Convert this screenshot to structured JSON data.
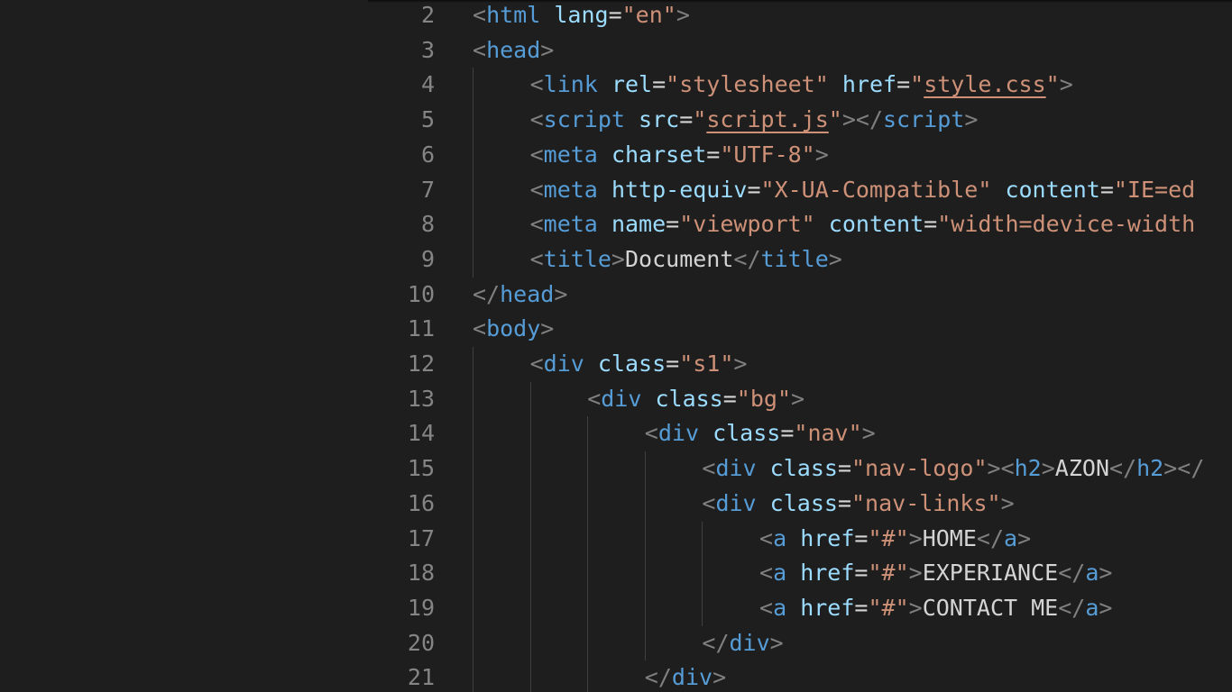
{
  "colors": {
    "background": "#1e1e1e",
    "line_number": "#858585",
    "bracket": "#808080",
    "tag": "#569cd6",
    "attribute": "#9cdcfe",
    "string": "#ce9178",
    "text": "#d4d4d4"
  },
  "editor": {
    "lines": [
      {
        "num": "2",
        "indent": 0,
        "tokens": [
          [
            "b",
            "<"
          ],
          [
            "t",
            "html"
          ],
          [
            "w",
            " "
          ],
          [
            "a",
            "lang"
          ],
          [
            "w",
            "="
          ],
          [
            "s",
            "\"en\""
          ],
          [
            "b",
            ">"
          ]
        ]
      },
      {
        "num": "3",
        "indent": 0,
        "tokens": [
          [
            "b",
            "<"
          ],
          [
            "t",
            "head"
          ],
          [
            "b",
            ">"
          ]
        ]
      },
      {
        "num": "4",
        "indent": 1,
        "tokens": [
          [
            "b",
            "<"
          ],
          [
            "t",
            "link"
          ],
          [
            "w",
            " "
          ],
          [
            "a",
            "rel"
          ],
          [
            "w",
            "="
          ],
          [
            "s",
            "\"stylesheet\""
          ],
          [
            "w",
            " "
          ],
          [
            "a",
            "href"
          ],
          [
            "w",
            "="
          ],
          [
            "s",
            "\""
          ],
          [
            "u",
            "style.css"
          ],
          [
            "s",
            "\""
          ],
          [
            "b",
            ">"
          ]
        ]
      },
      {
        "num": "5",
        "indent": 1,
        "tokens": [
          [
            "b",
            "<"
          ],
          [
            "t",
            "script"
          ],
          [
            "w",
            " "
          ],
          [
            "a",
            "src"
          ],
          [
            "w",
            "="
          ],
          [
            "s",
            "\""
          ],
          [
            "u",
            "script.js"
          ],
          [
            "s",
            "\""
          ],
          [
            "b",
            "></"
          ],
          [
            "t",
            "script"
          ],
          [
            "b",
            ">"
          ]
        ]
      },
      {
        "num": "6",
        "indent": 1,
        "tokens": [
          [
            "b",
            "<"
          ],
          [
            "t",
            "meta"
          ],
          [
            "w",
            " "
          ],
          [
            "a",
            "charset"
          ],
          [
            "w",
            "="
          ],
          [
            "s",
            "\"UTF-8\""
          ],
          [
            "b",
            ">"
          ]
        ]
      },
      {
        "num": "7",
        "indent": 1,
        "tokens": [
          [
            "b",
            "<"
          ],
          [
            "t",
            "meta"
          ],
          [
            "w",
            " "
          ],
          [
            "a",
            "http-equiv"
          ],
          [
            "w",
            "="
          ],
          [
            "s",
            "\"X-UA-Compatible\""
          ],
          [
            "w",
            " "
          ],
          [
            "a",
            "content"
          ],
          [
            "w",
            "="
          ],
          [
            "s",
            "\"IE=ed"
          ]
        ]
      },
      {
        "num": "8",
        "indent": 1,
        "tokens": [
          [
            "b",
            "<"
          ],
          [
            "t",
            "meta"
          ],
          [
            "w",
            " "
          ],
          [
            "a",
            "name"
          ],
          [
            "w",
            "="
          ],
          [
            "s",
            "\"viewport\""
          ],
          [
            "w",
            " "
          ],
          [
            "a",
            "content"
          ],
          [
            "w",
            "="
          ],
          [
            "s",
            "\"width=device-width"
          ]
        ]
      },
      {
        "num": "9",
        "indent": 1,
        "tokens": [
          [
            "b",
            "<"
          ],
          [
            "t",
            "title"
          ],
          [
            "b",
            ">"
          ],
          [
            "x",
            "Document"
          ],
          [
            "b",
            "</"
          ],
          [
            "t",
            "title"
          ],
          [
            "b",
            ">"
          ]
        ]
      },
      {
        "num": "10",
        "indent": 0,
        "tokens": [
          [
            "b",
            "</"
          ],
          [
            "t",
            "head"
          ],
          [
            "b",
            ">"
          ]
        ]
      },
      {
        "num": "11",
        "indent": 0,
        "tokens": [
          [
            "b",
            "<"
          ],
          [
            "t",
            "body"
          ],
          [
            "b",
            ">"
          ]
        ]
      },
      {
        "num": "12",
        "indent": 1,
        "tokens": [
          [
            "b",
            "<"
          ],
          [
            "t",
            "div"
          ],
          [
            "w",
            " "
          ],
          [
            "a",
            "class"
          ],
          [
            "w",
            "="
          ],
          [
            "s",
            "\"s1\""
          ],
          [
            "b",
            ">"
          ]
        ]
      },
      {
        "num": "13",
        "indent": 2,
        "tokens": [
          [
            "b",
            "<"
          ],
          [
            "t",
            "div"
          ],
          [
            "w",
            " "
          ],
          [
            "a",
            "class"
          ],
          [
            "w",
            "="
          ],
          [
            "s",
            "\"bg\""
          ],
          [
            "b",
            ">"
          ]
        ]
      },
      {
        "num": "14",
        "indent": 3,
        "tokens": [
          [
            "b",
            "<"
          ],
          [
            "t",
            "div"
          ],
          [
            "w",
            " "
          ],
          [
            "a",
            "class"
          ],
          [
            "w",
            "="
          ],
          [
            "s",
            "\"nav\""
          ],
          [
            "b",
            ">"
          ]
        ]
      },
      {
        "num": "15",
        "indent": 4,
        "tokens": [
          [
            "b",
            "<"
          ],
          [
            "t",
            "div"
          ],
          [
            "w",
            " "
          ],
          [
            "a",
            "class"
          ],
          [
            "w",
            "="
          ],
          [
            "s",
            "\"nav-logo\""
          ],
          [
            "b",
            "><"
          ],
          [
            "t",
            "h2"
          ],
          [
            "b",
            ">"
          ],
          [
            "x",
            "AZON"
          ],
          [
            "b",
            "</"
          ],
          [
            "t",
            "h2"
          ],
          [
            "b",
            "></"
          ]
        ]
      },
      {
        "num": "16",
        "indent": 4,
        "tokens": [
          [
            "b",
            "<"
          ],
          [
            "t",
            "div"
          ],
          [
            "w",
            " "
          ],
          [
            "a",
            "class"
          ],
          [
            "w",
            "="
          ],
          [
            "s",
            "\"nav-links\""
          ],
          [
            "b",
            ">"
          ]
        ]
      },
      {
        "num": "17",
        "indent": 5,
        "tokens": [
          [
            "b",
            "<"
          ],
          [
            "t",
            "a"
          ],
          [
            "w",
            " "
          ],
          [
            "a",
            "href"
          ],
          [
            "w",
            "="
          ],
          [
            "s",
            "\"#\""
          ],
          [
            "b",
            ">"
          ],
          [
            "x",
            "HOME"
          ],
          [
            "b",
            "</"
          ],
          [
            "t",
            "a"
          ],
          [
            "b",
            ">"
          ]
        ]
      },
      {
        "num": "18",
        "indent": 5,
        "tokens": [
          [
            "b",
            "<"
          ],
          [
            "t",
            "a"
          ],
          [
            "w",
            " "
          ],
          [
            "a",
            "href"
          ],
          [
            "w",
            "="
          ],
          [
            "s",
            "\"#\""
          ],
          [
            "b",
            ">"
          ],
          [
            "x",
            "EXPERIANCE"
          ],
          [
            "b",
            "</"
          ],
          [
            "t",
            "a"
          ],
          [
            "b",
            ">"
          ]
        ]
      },
      {
        "num": "19",
        "indent": 5,
        "tokens": [
          [
            "b",
            "<"
          ],
          [
            "t",
            "a"
          ],
          [
            "w",
            " "
          ],
          [
            "a",
            "href"
          ],
          [
            "w",
            "="
          ],
          [
            "s",
            "\"#\""
          ],
          [
            "b",
            ">"
          ],
          [
            "x",
            "CONTACT ME"
          ],
          [
            "b",
            "</"
          ],
          [
            "t",
            "a"
          ],
          [
            "b",
            ">"
          ]
        ]
      },
      {
        "num": "20",
        "indent": 4,
        "tokens": [
          [
            "b",
            "</"
          ],
          [
            "t",
            "div"
          ],
          [
            "b",
            ">"
          ]
        ]
      },
      {
        "num": "21",
        "indent": 3,
        "tokens": [
          [
            "b",
            "</"
          ],
          [
            "t",
            "div"
          ],
          [
            "b",
            ">"
          ]
        ]
      }
    ]
  }
}
